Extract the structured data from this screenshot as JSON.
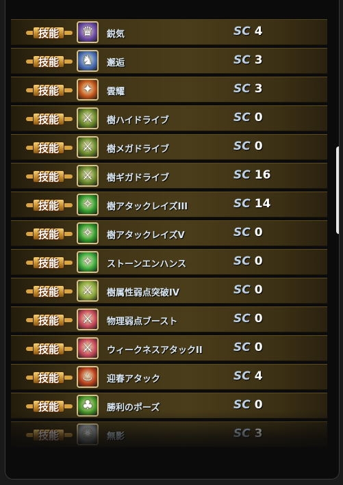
{
  "badge_label": "技能",
  "sc_label": "SC",
  "skills": [
    {
      "name": "鋭気",
      "sc": "4",
      "icon": "figure-purple-icon",
      "icon_color": "#6a4aa8"
    },
    {
      "name": "邂逅",
      "sc": "3",
      "icon": "figure-red-blue-icon",
      "icon_color": "#4a70b8"
    },
    {
      "name": "雲耀",
      "sc": "3",
      "icon": "flame-slash-icon",
      "icon_color": "#c05418"
    },
    {
      "name": "樹ハイドライブ",
      "sc": "0",
      "icon": "wind-sword-icon",
      "icon_color": "#6a8a2a"
    },
    {
      "name": "樹メガドライブ",
      "sc": "0",
      "icon": "wind-sword-icon",
      "icon_color": "#6a8a2a"
    },
    {
      "name": "樹ギガドライブ",
      "sc": "16",
      "icon": "wind-sword-icon",
      "icon_color": "#6a8a2a"
    },
    {
      "name": "樹アタックレイズIII",
      "sc": "14",
      "icon": "green-sparkle-icon",
      "icon_color": "#2f9a2a"
    },
    {
      "name": "樹アタックレイズV",
      "sc": "0",
      "icon": "green-sparkle-icon",
      "icon_color": "#2f9a2a"
    },
    {
      "name": "ストーンエンハンス",
      "sc": "0",
      "icon": "green-sparkle-icon",
      "icon_color": "#3aa83a"
    },
    {
      "name": "樹属性弱点突破IV",
      "sc": "0",
      "icon": "weak-green-sword-icon",
      "icon_color": "#8aa83a"
    },
    {
      "name": "物理弱点ブースト",
      "sc": "0",
      "icon": "weak-red-sword-icon",
      "icon_color": "#c84a5a"
    },
    {
      "name": "ウィークネスアタックII",
      "sc": "0",
      "icon": "weak-red-sword-icon",
      "icon_color": "#c84a5a"
    },
    {
      "name": "迎春アタック",
      "sc": "4",
      "icon": "fire-figure-icon",
      "icon_color": "#b8401a"
    },
    {
      "name": "勝利のポーズ",
      "sc": "0",
      "icon": "green-figure-icon",
      "icon_color": "#4a9a2a"
    },
    {
      "name": "無影",
      "sc": "3",
      "icon": "white-burst-icon",
      "icon_color": "#9aa0a8"
    }
  ]
}
